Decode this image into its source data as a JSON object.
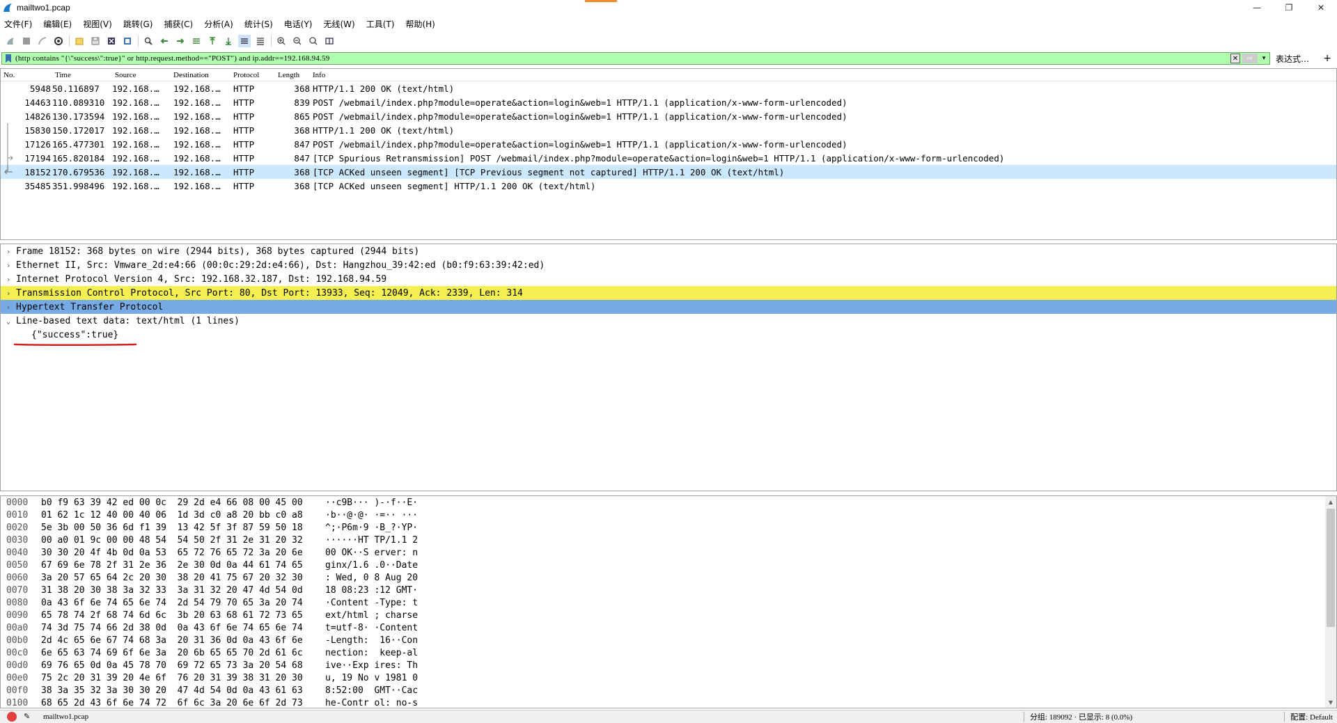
{
  "window": {
    "title": "mailtwo1.pcap",
    "minimize": "—",
    "restore": "❐",
    "close": "✕"
  },
  "menu": [
    "文件(F)",
    "编辑(E)",
    "视图(V)",
    "跳转(G)",
    "捕获(C)",
    "分析(A)",
    "统计(S)",
    "电话(Y)",
    "无线(W)",
    "工具(T)",
    "帮助(H)"
  ],
  "filter": {
    "value": "(http contains \"{\\\"success\\\":true}\" or http.request.method==\"POST\") and ip.addr==192.168.94.59",
    "expression_label": "表达式…",
    "plus": "+"
  },
  "packet_list": {
    "headers": [
      "No.",
      "Time",
      "Source",
      "Destination",
      "Protocol",
      "Length",
      "Info"
    ],
    "rows": [
      {
        "no": "5948",
        "time": "50.116897",
        "src": "192.168.…",
        "dst": "192.168.…",
        "proto": "HTTP",
        "len": "368",
        "info": "HTTP/1.1 200 OK  (text/html)"
      },
      {
        "no": "14463",
        "time": "110.089310",
        "src": "192.168.…",
        "dst": "192.168.…",
        "proto": "HTTP",
        "len": "839",
        "info": "POST /webmail/index.php?module=operate&action=login&web=1 HTTP/1.1  (application/x-www-form-urlencoded)"
      },
      {
        "no": "14826",
        "time": "130.173594",
        "src": "192.168.…",
        "dst": "192.168.…",
        "proto": "HTTP",
        "len": "865",
        "info": "POST /webmail/index.php?module=operate&action=login&web=1 HTTP/1.1  (application/x-www-form-urlencoded)"
      },
      {
        "no": "15830",
        "time": "150.172017",
        "src": "192.168.…",
        "dst": "192.168.…",
        "proto": "HTTP",
        "len": "368",
        "info": "HTTP/1.1 200 OK  (text/html)"
      },
      {
        "no": "17126",
        "time": "165.477301",
        "src": "192.168.…",
        "dst": "192.168.…",
        "proto": "HTTP",
        "len": "847",
        "info": "POST /webmail/index.php?module=operate&action=login&web=1 HTTP/1.1  (application/x-www-form-urlencoded)"
      },
      {
        "no": "17194",
        "time": "165.820184",
        "src": "192.168.…",
        "dst": "192.168.…",
        "proto": "HTTP",
        "len": "847",
        "info": "[TCP Spurious Retransmission] POST /webmail/index.php?module=operate&action=login&web=1 HTTP/1.1  (application/x-www-form-urlencoded)"
      },
      {
        "no": "18152",
        "time": "170.679536",
        "src": "192.168.…",
        "dst": "192.168.…",
        "proto": "HTTP",
        "len": "368",
        "info": "[TCP ACKed unseen segment] [TCP Previous segment not captured] HTTP/1.1 200 OK  (text/html)"
      },
      {
        "no": "35485",
        "time": "351.998496",
        "src": "192.168.…",
        "dst": "192.168.…",
        "proto": "HTTP",
        "len": "368",
        "info": "[TCP ACKed unseen segment] HTTP/1.1 200 OK  (text/html)"
      }
    ]
  },
  "details": {
    "rows": [
      {
        "arrow": "›",
        "text": "Frame 18152: 368 bytes on wire (2944 bits), 368 bytes captured (2944 bits)"
      },
      {
        "arrow": "›",
        "text": "Ethernet II, Src: Vmware_2d:e4:66 (00:0c:29:2d:e4:66), Dst: Hangzhou_39:42:ed (b0:f9:63:39:42:ed)"
      },
      {
        "arrow": "›",
        "text": "Internet Protocol Version 4, Src: 192.168.32.187, Dst: 192.168.94.59"
      },
      {
        "arrow": "›",
        "text": "Transmission Control Protocol, Src Port: 80, Dst Port: 13933, Seq: 12049, Ack: 2339, Len: 314"
      },
      {
        "arrow": "›",
        "text": "Hypertext Transfer Protocol"
      },
      {
        "arrow": "⌄",
        "text": "Line-based text data: text/html (1 lines)"
      }
    ],
    "child": "{\"success\":true}",
    "highlight_tcp": "#f4f051",
    "highlight_http": "#77abe6",
    "underline_color": "#d42020"
  },
  "bytes": {
    "rows": [
      {
        "off": "0000",
        "hex": "b0 f9 63 39 42 ed 00 0c  29 2d e4 66 08 00 45 00",
        "ascii": "··c9B··· )-·f··E·"
      },
      {
        "off": "0010",
        "hex": "01 62 1c 12 40 00 40 06  1d 3d c0 a8 20 bb c0 a8",
        "ascii": "·b··@·@· ·=·· ···"
      },
      {
        "off": "0020",
        "hex": "5e 3b 00 50 36 6d f1 39  13 42 5f 3f 87 59 50 18",
        "ascii": "^;·P6m·9 ·B_?·YP·"
      },
      {
        "off": "0030",
        "hex": "00 a0 01 9c 00 00 48 54  54 50 2f 31 2e 31 20 32",
        "ascii": "······HT TP/1.1 2"
      },
      {
        "off": "0040",
        "hex": "30 30 20 4f 4b 0d 0a 53  65 72 76 65 72 3a 20 6e",
        "ascii": "00 OK··S erver: n"
      },
      {
        "off": "0050",
        "hex": "67 69 6e 78 2f 31 2e 36  2e 30 0d 0a 44 61 74 65",
        "ascii": "ginx/1.6 .0··Date"
      },
      {
        "off": "0060",
        "hex": "3a 20 57 65 64 2c 20 30  38 20 41 75 67 20 32 30",
        "ascii": ": Wed, 0 8 Aug 20"
      },
      {
        "off": "0070",
        "hex": "31 38 20 30 38 3a 32 33  3a 31 32 20 47 4d 54 0d",
        "ascii": "18 08:23 :12 GMT·"
      },
      {
        "off": "0080",
        "hex": "0a 43 6f 6e 74 65 6e 74  2d 54 79 70 65 3a 20 74",
        "ascii": "·Content -Type: t"
      },
      {
        "off": "0090",
        "hex": "65 78 74 2f 68 74 6d 6c  3b 20 63 68 61 72 73 65",
        "ascii": "ext/html ; charse"
      },
      {
        "off": "00a0",
        "hex": "74 3d 75 74 66 2d 38 0d  0a 43 6f 6e 74 65 6e 74",
        "ascii": "t=utf-8· ·Content"
      },
      {
        "off": "00b0",
        "hex": "2d 4c 65 6e 67 74 68 3a  20 31 36 0d 0a 43 6f 6e",
        "ascii": "-Length:  16··Con"
      },
      {
        "off": "00c0",
        "hex": "6e 65 63 74 69 6f 6e 3a  20 6b 65 65 70 2d 61 6c",
        "ascii": "nection:  keep-al"
      },
      {
        "off": "00d0",
        "hex": "69 76 65 0d 0a 45 78 70  69 72 65 73 3a 20 54 68",
        "ascii": "ive··Exp ires: Th"
      },
      {
        "off": "00e0",
        "hex": "75 2c 20 31 39 20 4e 6f  76 20 31 39 38 31 20 30",
        "ascii": "u, 19 No v 1981 0"
      },
      {
        "off": "00f0",
        "hex": "38 3a 35 32 3a 30 30 20  47 4d 54 0d 0a 43 61 63",
        "ascii": "8:52:00  GMT··Cac"
      },
      {
        "off": "0100",
        "hex": "68 65 2d 43 6f 6e 74 72  6f 6c 3a 20 6e 6f 2d 73",
        "ascii": "he-Contr ol: no-s"
      }
    ]
  },
  "status": {
    "file": "mailtwo1.pcap",
    "packets": "分组: 189092 · 已显示: 8 (0.0%)",
    "profile": "配置: Default"
  },
  "colors": {
    "filter_bg": "#afffaf",
    "selected_row": "#cce8ff",
    "accent": "#f08c2e"
  }
}
